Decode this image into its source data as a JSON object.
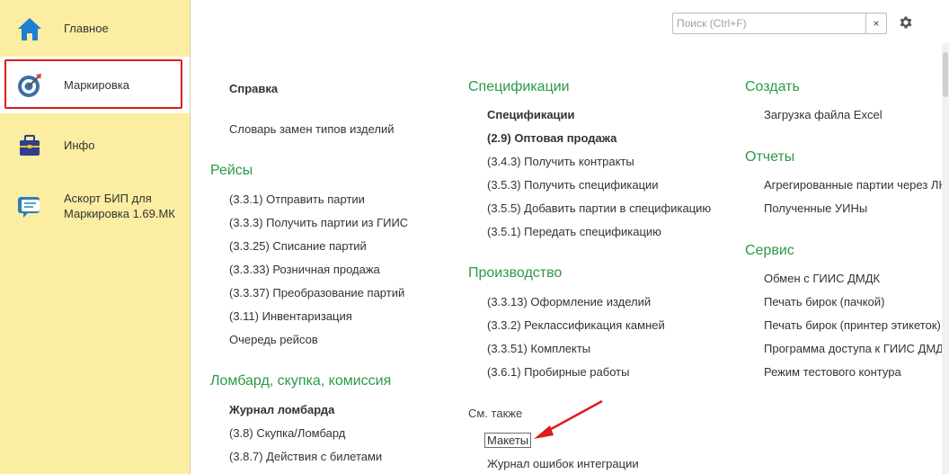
{
  "sidebar": {
    "items": [
      {
        "label": "Главное",
        "icon": "home-icon"
      },
      {
        "label": "Маркировка",
        "icon": "target-icon"
      },
      {
        "label": "Инфо",
        "icon": "briefcase-icon"
      },
      {
        "label_line1": "Аскорт БИП для",
        "label_line2": "Маркировка 1.69.МК",
        "icon": "chat-icon"
      }
    ]
  },
  "search": {
    "placeholder": "Поиск (Ctrl+F)",
    "value": "",
    "clear": "×"
  },
  "col1": {
    "spravka": "Справка",
    "slovar": "Словарь замен типов изделий",
    "reisy_title": "Рейсы",
    "reisy": [
      "(3.3.1) Отправить партии",
      "(3.3.3) Получить партии из ГИИС",
      "(3.3.25) Списание партий",
      "(3.3.33) Розничная продажа",
      "(3.3.37) Преобразование партий",
      "(3.11) Инвентаризация",
      "Очередь рейсов"
    ],
    "lombard_title": "Ломбард, скупка, комиссия",
    "lombard": [
      "Журнал ломбарда",
      "(3.8) Скупка/Ломбард",
      "(3.8.7) Действия с билетами"
    ]
  },
  "col2": {
    "spec_title": "Спецификации",
    "spec": [
      "Спецификации",
      "(2.9) Оптовая продажа",
      "(3.4.3) Получить контракты",
      "(3.5.3) Получить спецификации",
      "(3.5.5) Добавить партии в спецификацию",
      "(3.5.1) Передать спецификацию"
    ],
    "prod_title": "Производство",
    "prod": [
      "(3.3.13) Оформление изделий",
      "(3.3.2) Реклассификация камней",
      "(3.3.51) Комплекты",
      "(3.6.1) Пробирные работы"
    ],
    "seealso_title": "См. также",
    "seealso": [
      "Макеты",
      "Журнал ошибок интеграции"
    ]
  },
  "col3": {
    "create_title": "Создать",
    "create": [
      "Загрузка файла Excel"
    ],
    "reports_title": "Отчеты",
    "reports": [
      "Агрегированные партии через ЛК",
      "Полученные УИНы"
    ],
    "service_title": "Сервис",
    "service": [
      "Обмен с ГИИС ДМДК",
      "Печать бирок (пачкой)",
      "Печать бирок (принтер этикеток)",
      "Программа доступа к ГИИС ДМДК",
      "Режим тестового контура"
    ]
  },
  "colors": {
    "accent_green": "#2a9a45",
    "sidebar_bg": "#fbeda2",
    "highlight_red": "#e01b1b"
  }
}
